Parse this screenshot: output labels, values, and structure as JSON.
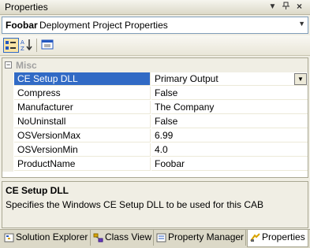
{
  "title_bar": {
    "title": "Properties",
    "dropdown_icon": "chevron-down-icon",
    "pin_icon": "pin-icon",
    "close_icon": "close-icon"
  },
  "object_selector": {
    "name": "Foobar",
    "type": "Deployment Project Properties"
  },
  "toolbar": {
    "buttons": [
      "categorized-icon",
      "alphabetical-icon",
      "property-pages-icon"
    ]
  },
  "grid": {
    "category": {
      "label": "Misc",
      "expander": "⊟"
    },
    "rows": [
      {
        "name": "CE Setup DLL",
        "value": "Primary Output",
        "selected": true
      },
      {
        "name": "Compress",
        "value": "False"
      },
      {
        "name": "Manufacturer",
        "value": "The Company"
      },
      {
        "name": "NoUninstall",
        "value": "False"
      },
      {
        "name": "OSVersionMax",
        "value": "6.99"
      },
      {
        "name": "OSVersionMin",
        "value": "4.0"
      },
      {
        "name": "ProductName",
        "value": "Foobar"
      }
    ]
  },
  "description": {
    "title": "CE Setup DLL",
    "text": "Specifies the Windows CE Setup DLL to be used for this CAB"
  },
  "tabs": [
    {
      "label": "Solution Explorer",
      "icon": "solution-explorer-icon"
    },
    {
      "label": "Class View",
      "icon": "class-view-icon"
    },
    {
      "label": "Property Manager",
      "icon": "property-manager-icon"
    },
    {
      "label": "Properties",
      "icon": "properties-icon",
      "active": true
    }
  ]
}
